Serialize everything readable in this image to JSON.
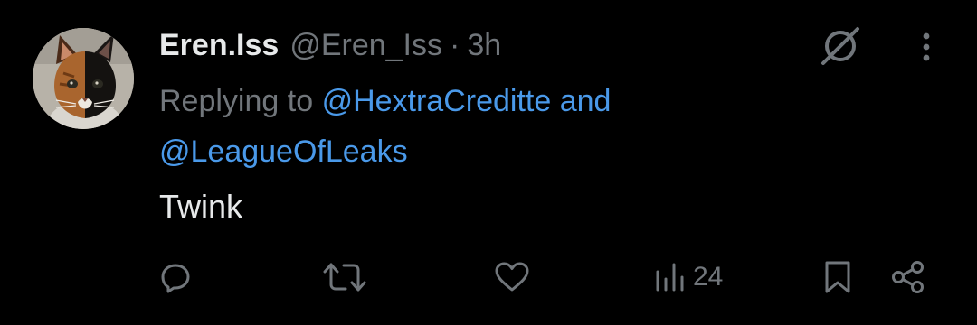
{
  "tweet": {
    "display_name": "Eren.Iss",
    "handle": "@Eren_Iss",
    "separator": "·",
    "time": "3h",
    "replying_prefix": "Replying to",
    "mentions": [
      "@HextraCreditte",
      "@LeagueOfLeaks"
    ],
    "conjunction": "and",
    "text": "Twink"
  },
  "actions": {
    "reply_icon": "reply-icon",
    "retweet_icon": "retweet-icon",
    "like_icon": "heart-icon",
    "views_icon": "views-bar-chart-icon",
    "views_count": "24",
    "bookmark_icon": "bookmark-icon",
    "share_icon": "share-icon"
  },
  "header_icons": {
    "grok": "grok-slash-circle-icon",
    "more": "more-vertical-icon"
  },
  "colors": {
    "background": "#000000",
    "primary_text": "#e7e9ea",
    "secondary_text": "#71767b",
    "mention": "#4a99e9"
  }
}
